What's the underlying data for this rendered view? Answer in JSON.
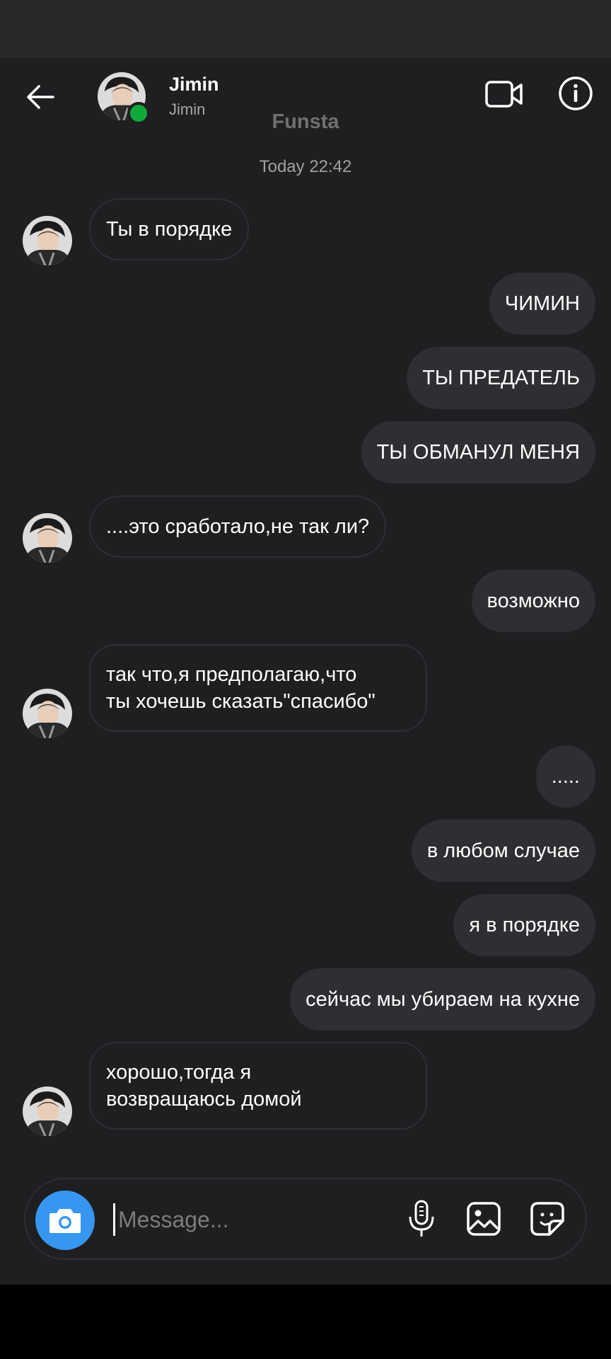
{
  "header": {
    "name": "Jimin",
    "username": "Jimin",
    "watermark": "Funsta",
    "online_color": "#11a93b",
    "icons": [
      "back-arrow-icon",
      "video-camera-icon",
      "info-icon"
    ]
  },
  "timestamp": "Today 22:42",
  "messages": [
    {
      "side": "in",
      "text": "Ты в порядке"
    },
    {
      "side": "out",
      "text": "ЧИМИН"
    },
    {
      "side": "out",
      "text": "ТЫ ПРЕДАТЕЛЬ"
    },
    {
      "side": "out",
      "text": "ТЫ ОБМАНУЛ МЕНЯ"
    },
    {
      "side": "in",
      "text": "....это сработало,не так ли?"
    },
    {
      "side": "out",
      "text": "возможно"
    },
    {
      "side": "in",
      "lines": [
        "так что,я предполагаю,что",
        "ты хочешь сказать\"спасибо\""
      ]
    },
    {
      "side": "out",
      "text": "....."
    },
    {
      "side": "out",
      "text": "в любом случае"
    },
    {
      "side": "out",
      "text": "я в порядке"
    },
    {
      "side": "out",
      "text": "сейчас мы убираем на кухне"
    },
    {
      "side": "in",
      "lines": [
        "хорошо,тогда я",
        "возвращаюсь домой"
      ]
    }
  ],
  "composer": {
    "placeholder": "Message...",
    "accent": "#3797f0",
    "icons": [
      "camera-icon",
      "microphone-icon",
      "gallery-icon",
      "sticker-icon"
    ]
  }
}
